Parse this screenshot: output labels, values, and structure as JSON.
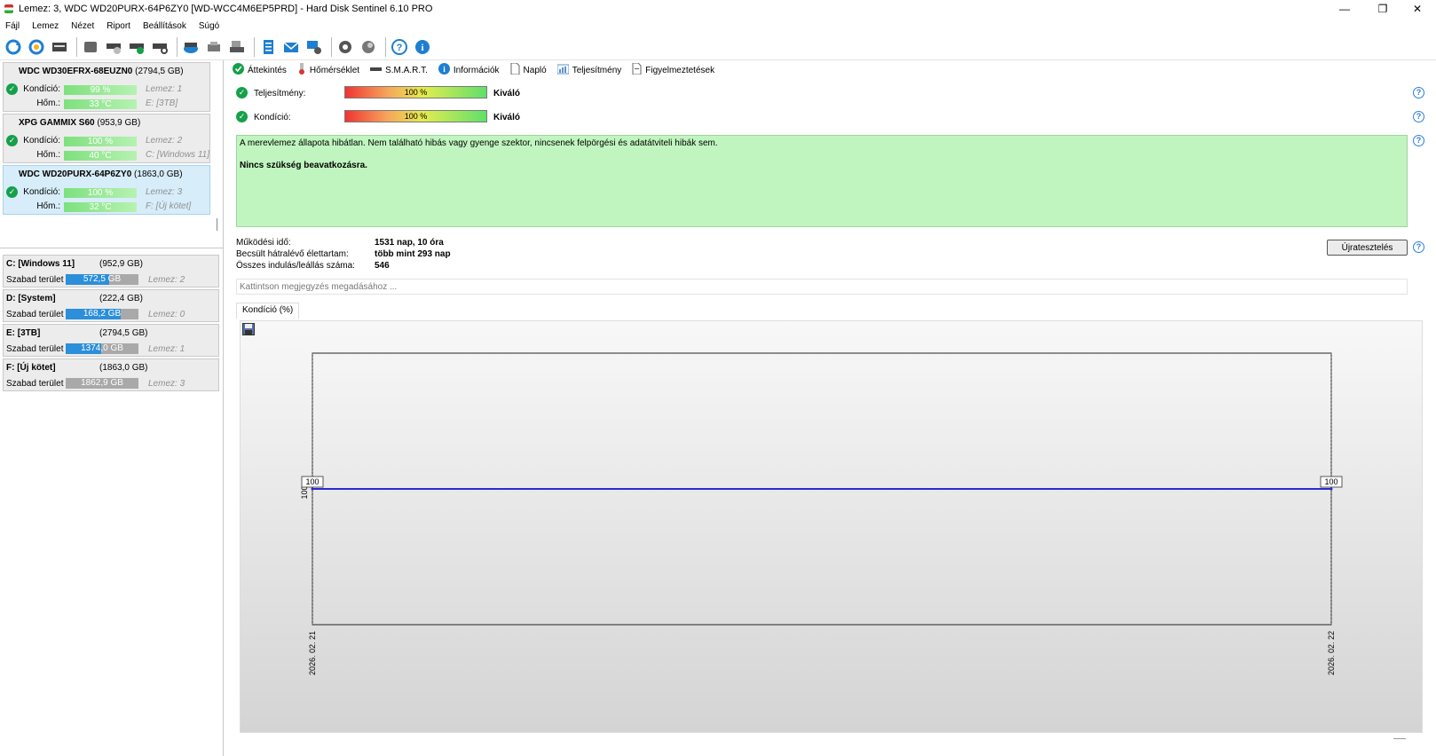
{
  "window": {
    "title": "Lemez: 3, WDC WD20PURX-64P6ZY0 [WD-WCC4M6EP5PRD]  -  Hard Disk Sentinel 6.10 PRO",
    "minimize": "—",
    "maximize": "❐",
    "close": "✕"
  },
  "menu": [
    "Fájl",
    "Lemez",
    "Nézet",
    "Riport",
    "Beállítások",
    "Súgó"
  ],
  "disks": [
    {
      "name": "WDC WD30EFRX-68EUZN0",
      "capacity": "(2794,5 GB)",
      "health_label": "Kondíció:",
      "health": "99 %",
      "health_pct": 99,
      "temp_label": "Hőm.:",
      "temp": "33 °C",
      "disk_no": "Lemez: 1",
      "volume": "E: [3TB]",
      "selected": false
    },
    {
      "name": "XPG GAMMIX S60",
      "capacity": "(953,9 GB)",
      "health_label": "Kondíció:",
      "health": "100 %",
      "health_pct": 100,
      "temp_label": "Hőm.:",
      "temp": "40 °C",
      "disk_no": "Lemez: 2",
      "volume": "C: [Windows 11]",
      "selected": false
    },
    {
      "name": "WDC WD20PURX-64P6ZY0",
      "capacity": "(1863,0 GB)",
      "health_label": "Kondíció:",
      "health": "100 %",
      "health_pct": 100,
      "temp_label": "Hőm.:",
      "temp": "32 °C",
      "disk_no": "Lemez: 3",
      "volume": "F: [Új kötet]",
      "selected": true
    }
  ],
  "volumes": [
    {
      "name": "C: [Windows 11]",
      "capacity": "(952,9 GB)",
      "free_label": "Szabad terület",
      "free": "572,5 GB",
      "free_pct": 60,
      "disk": "Lemez: 2"
    },
    {
      "name": "D: [System]",
      "capacity": "(222,4 GB)",
      "free_label": "Szabad terület",
      "free": "168,2 GB",
      "free_pct": 76,
      "disk": "Lemez: 0"
    },
    {
      "name": "E: [3TB]",
      "capacity": "(2794,5 GB)",
      "free_label": "Szabad terület",
      "free": "1374,0 GB",
      "free_pct": 49,
      "disk": "Lemez: 1"
    },
    {
      "name": "F: [Új kötet]",
      "capacity": "(1863,0 GB)",
      "free_label": "Szabad terület",
      "free": "1862,9 GB",
      "free_pct": 0,
      "disk": "Lemez: 3"
    }
  ],
  "tabs": [
    "Áttekintés",
    "Hőmérséklet",
    "S.M.A.R.T.",
    "Információk",
    "Napló",
    "Teljesítmény",
    "Figyelmeztetések"
  ],
  "overview": {
    "performance_label": "Teljesítmény:",
    "performance_value": "100 %",
    "performance_pct": 100,
    "performance_rating": "Kiváló",
    "health_label": "Kondíció:",
    "health_value": "100 %",
    "health_pct": 100,
    "health_rating": "Kiváló",
    "status_text": "A merevlemez állapota hibátlan. Nem található hibás vagy gyenge szektor, nincsenek felpörgési és adatátviteli hibák sem.",
    "status_action": "Nincs szükség beavatkozásra.",
    "uptime_label": "Működési idő:",
    "uptime": "1531 nap, 10 óra",
    "lifetime_label": "Becsült hátralévő élettartam:",
    "lifetime": "több mint 293 nap",
    "starts_label": "Összes indulás/leállás száma:",
    "starts": "546",
    "retest_button": "Újratesztelés",
    "note_placeholder": "Kattintson megjegyzés megadásához ..."
  },
  "chart_tab": "Kondíció  (%)",
  "chart_data": {
    "type": "line",
    "x": [
      "2026. 02. 21",
      "2026. 02. 22"
    ],
    "series": [
      {
        "values": [
          100,
          100
        ]
      }
    ],
    "ylim": [
      0,
      200
    ],
    "ytick_label": "100",
    "data_labels": [
      "100",
      "100"
    ],
    "color": "#2b2bd6"
  }
}
